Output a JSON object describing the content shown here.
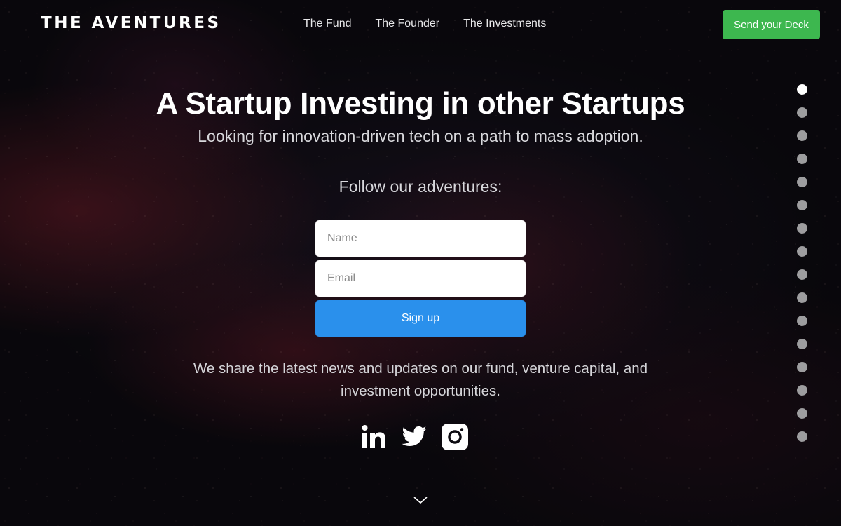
{
  "header": {
    "logo_text": "THE AVENTURES",
    "nav": [
      {
        "label": "The Fund"
      },
      {
        "label": "The Founder"
      },
      {
        "label": "The Investments"
      }
    ],
    "cta_label": "Send your Deck"
  },
  "hero": {
    "title": "A Startup Investing in other Startups",
    "subtitle": "Looking for innovation-driven tech on a path to mass adoption.",
    "follow_label": "Follow our adventures:"
  },
  "form": {
    "name_placeholder": "Name",
    "email_placeholder": "Email",
    "submit_label": "Sign up"
  },
  "blurb": "We share the latest news and updates on our fund, venture capital, and investment opportunities.",
  "social": [
    {
      "icon": "linkedin-icon"
    },
    {
      "icon": "twitter-icon"
    },
    {
      "icon": "instagram-icon"
    }
  ],
  "pagination": {
    "total": 16,
    "active_index": 0
  },
  "colors": {
    "cta_green": "#3db74f",
    "signup_blue": "#2a90ec",
    "dot_inactive": "#9d9d9f",
    "dot_active": "#ffffff"
  }
}
